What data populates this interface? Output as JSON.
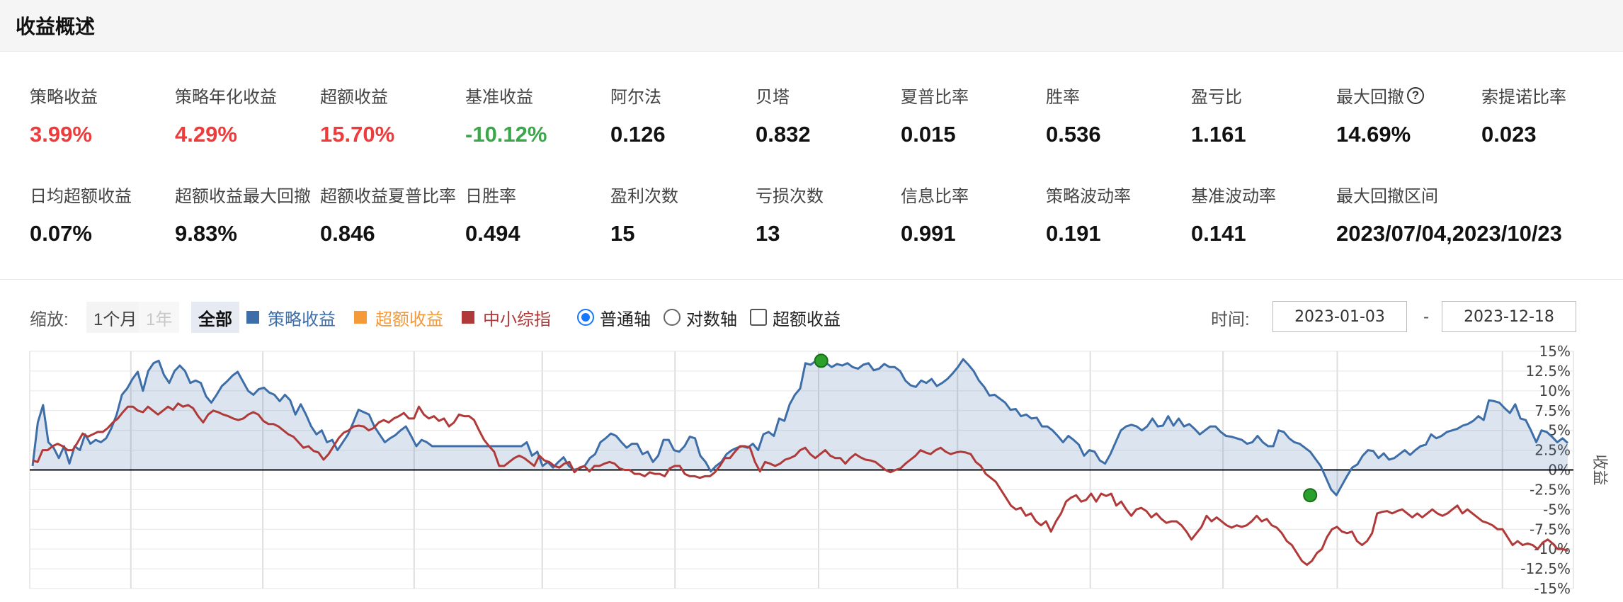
{
  "header": {
    "title": "收益概述"
  },
  "metrics_row1": [
    {
      "label": "策略收益",
      "value": "3.99%",
      "tone": "pos"
    },
    {
      "label": "策略年化收益",
      "value": "4.29%",
      "tone": "pos"
    },
    {
      "label": "超额收益",
      "value": "15.70%",
      "tone": "pos"
    },
    {
      "label": "基准收益",
      "value": "-10.12%",
      "tone": "neg"
    },
    {
      "label": "阿尔法",
      "value": "0.126",
      "tone": ""
    },
    {
      "label": "贝塔",
      "value": "0.832",
      "tone": ""
    },
    {
      "label": "夏普比率",
      "value": "0.015",
      "tone": ""
    },
    {
      "label": "胜率",
      "value": "0.536",
      "tone": ""
    },
    {
      "label": "盈亏比",
      "value": "1.161",
      "tone": ""
    },
    {
      "label": "最大回撤",
      "value": "14.69%",
      "tone": "",
      "help": "?"
    },
    {
      "label": "索提诺比率",
      "value": "0.023",
      "tone": ""
    }
  ],
  "metrics_row2": [
    {
      "label": "日均超额收益",
      "value": "0.07%"
    },
    {
      "label": "超额收益最大回撤",
      "value": "9.83%"
    },
    {
      "label": "超额收益夏普比率",
      "value": "0.846"
    },
    {
      "label": "日胜率",
      "value": "0.494"
    },
    {
      "label": "盈利次数",
      "value": "15"
    },
    {
      "label": "亏损次数",
      "value": "13"
    },
    {
      "label": "信息比率",
      "value": "0.991"
    },
    {
      "label": "策略波动率",
      "value": "0.191"
    },
    {
      "label": "基准波动率",
      "value": "0.141"
    },
    {
      "label": "最大回撤区间",
      "value": "2023/07/04,2023/10/23"
    }
  ],
  "toolbar": {
    "zoom_label": "缩放:",
    "zoom_options": [
      "1个月",
      "1年",
      "全部"
    ],
    "zoom_selected": "全部",
    "legend": [
      {
        "label": "策略收益",
        "color": "#3d6ea8"
      },
      {
        "label": "超额收益",
        "color": "#f59a38"
      },
      {
        "label": "中小综指",
        "color": "#b03a3a"
      }
    ],
    "axis_options": [
      "普通轴",
      "对数轴"
    ],
    "axis_selected": "普通轴",
    "excess_checkbox_label": "超额收益",
    "time_label": "时间:",
    "date_from": "2023-01-03",
    "date_sep": "-",
    "date_to": "2023-12-18"
  },
  "chart_data": {
    "type": "line",
    "ylabel": "收益",
    "yticks": [
      "15%",
      "12.5%",
      "10%",
      "7.5%",
      "5%",
      "2.5%",
      "0%",
      "-2.5%",
      "-5%",
      "-7.5%",
      "-10%",
      "-12.5%",
      "-15%"
    ],
    "ylim": [
      -15,
      15
    ],
    "grid": true,
    "series": [
      {
        "name": "策略收益",
        "color": "#3d6ea8",
        "fill": true,
        "values": [
          0.5,
          6.0,
          8.2,
          3.5,
          2.8,
          1.5,
          3.0,
          0.8,
          3.0,
          2.5,
          4.5,
          3.3,
          3.8,
          3.5,
          4.0,
          5.3,
          7.0,
          9.5,
          10.3,
          11.5,
          12.4,
          10.0,
          12.5,
          13.5,
          13.8,
          12.0,
          11.0,
          12.5,
          13.2,
          12.5,
          11.0,
          11.3,
          11.0,
          9.3,
          8.5,
          9.5,
          10.6,
          11.2,
          11.9,
          12.4,
          11.2,
          10.0,
          9.5,
          10.2,
          10.4,
          9.8,
          9.5,
          8.7,
          9.5,
          8.8,
          7.0,
          8.3,
          7.0,
          5.5,
          4.5,
          5.0,
          3.5,
          3.8,
          2.5,
          3.5,
          4.5,
          6.0,
          7.6,
          7.3,
          7.0,
          5.5,
          4.5,
          3.5,
          4.0,
          4.4,
          5.0,
          5.5,
          4.3,
          3.0,
          3.8,
          3.5,
          3.0,
          3.0,
          3.0,
          3.0,
          3.0,
          3.0,
          3.0,
          3.0,
          3.0,
          3.0,
          3.0,
          3.0,
          3.0,
          3.0,
          3.0,
          3.0,
          3.0,
          3.0,
          3.5,
          1.8,
          2.3,
          0.5,
          1.0,
          0.3,
          1.0,
          1.6,
          0.5,
          0.0,
          0.2,
          0.5,
          1.5,
          2.0,
          3.5,
          4.0,
          4.6,
          4.3,
          3.5,
          2.8,
          3.3,
          3.3,
          2.0,
          2.3,
          1.0,
          1.8,
          3.8,
          3.8,
          2.5,
          2.3,
          3.0,
          4.2,
          4.0,
          1.8,
          1.0,
          -0.2,
          0.5,
          1.0,
          2.0,
          2.5,
          2.8,
          3.0,
          2.8,
          3.3,
          2.5,
          4.5,
          4.8,
          4.3,
          6.5,
          6.2,
          8.3,
          9.5,
          10.3,
          13.5,
          13.3,
          13.8,
          13.4,
          13.5,
          13.0,
          13.4,
          13.2,
          13.5,
          13.0,
          12.8,
          13.3,
          13.5,
          12.6,
          12.8,
          13.4,
          13.0,
          13.0,
          12.5,
          11.3,
          10.7,
          10.5,
          11.3,
          11.0,
          11.5,
          10.6,
          11.0,
          11.5,
          12.2,
          13.0,
          14.0,
          13.3,
          12.5,
          11.3,
          10.5,
          9.4,
          9.5,
          9.0,
          8.5,
          7.6,
          7.7,
          6.8,
          7.0,
          6.5,
          6.6,
          5.5,
          5.5,
          5.0,
          4.3,
          3.5,
          4.3,
          3.8,
          3.2,
          1.8,
          2.5,
          2.3,
          1.2,
          0.8,
          2.0,
          3.5,
          5.0,
          5.5,
          5.7,
          5.5,
          5.0,
          5.5,
          6.5,
          5.5,
          5.6,
          6.8,
          5.6,
          6.5,
          5.5,
          5.8,
          5.2,
          4.5,
          5.0,
          5.5,
          5.5,
          4.8,
          4.3,
          4.2,
          4.0,
          3.8,
          3.3,
          3.5,
          4.3,
          3.5,
          3.0,
          3.0,
          5.0,
          4.8,
          4.0,
          3.5,
          3.3,
          2.8,
          2.3,
          1.4,
          0.5,
          -1.0,
          -2.5,
          -3.2,
          -2.0,
          -0.8,
          0.3,
          0.7,
          1.8,
          2.5,
          2.4,
          1.5,
          2.1,
          1.3,
          1.5,
          2.0,
          2.5,
          1.9,
          2.5,
          3.0,
          3.2,
          4.5,
          4.0,
          4.3,
          4.8,
          5.0,
          5.2,
          5.6,
          5.8,
          6.2,
          6.8,
          6.3,
          8.8,
          8.7,
          8.5,
          7.8,
          7.2,
          8.3,
          6.5,
          6.3,
          5.0,
          3.5,
          5.0,
          4.8,
          4.2,
          3.5,
          4.0,
          3.4
        ]
      },
      {
        "name": "中小综指",
        "color": "#b03a3a",
        "fill": false,
        "values": [
          1.2,
          1.0,
          2.5,
          2.5,
          3.0,
          3.3,
          3.0,
          2.5,
          2.5,
          3.5,
          4.6,
          4.2,
          4.5,
          4.8,
          4.8,
          5.3,
          6.0,
          6.5,
          7.3,
          8.0,
          8.0,
          7.5,
          7.3,
          8.0,
          7.5,
          7.0,
          7.5,
          8.0,
          7.6,
          8.4,
          8.0,
          8.2,
          7.8,
          6.8,
          6.0,
          7.0,
          7.5,
          7.3,
          7.0,
          6.8,
          6.5,
          6.3,
          6.5,
          7.0,
          7.3,
          7.0,
          6.2,
          5.8,
          5.8,
          5.5,
          5.0,
          4.5,
          4.2,
          3.5,
          2.8,
          3.0,
          2.4,
          2.2,
          1.3,
          2.0,
          3.0,
          4.0,
          4.7,
          5.0,
          5.5,
          5.6,
          5.5,
          5.0,
          5.3,
          6.0,
          6.3,
          6.0,
          6.5,
          6.8,
          7.2,
          6.5,
          6.5,
          8.0,
          7.0,
          6.5,
          6.8,
          6.2,
          6.5,
          5.5,
          6.0,
          7.0,
          6.8,
          6.8,
          6.3,
          5.0,
          3.8,
          3.0,
          2.3,
          0.5,
          0.5,
          1.0,
          1.5,
          1.8,
          1.5,
          1.0,
          0.5,
          1.8,
          1.2,
          1.0,
          0.5,
          0.3,
          0.8,
          1.0,
          -0.3,
          0.3,
          0.5,
          -0.2,
          0.5,
          0.5,
          0.8,
          1.0,
          0.8,
          0.2,
          0.0,
          0.0,
          -0.5,
          -0.5,
          -0.8,
          -0.3,
          -0.5,
          -0.5,
          -0.8,
          0.2,
          0.5,
          0.5,
          -0.5,
          -0.8,
          -0.8,
          -1.0,
          -0.8,
          -0.8,
          -0.3,
          0.5,
          1.5,
          1.5,
          2.3,
          3.0,
          3.0,
          2.8,
          1.0,
          -0.2,
          1.0,
          0.8,
          0.5,
          0.8,
          1.3,
          1.5,
          1.8,
          2.5,
          2.8,
          2.0,
          1.5,
          2.0,
          2.5,
          1.8,
          1.5,
          1.5,
          0.8,
          1.5,
          2.0,
          1.6,
          1.3,
          1.2,
          1.0,
          0.5,
          0.0,
          -0.3,
          0.0,
          0.2,
          0.8,
          1.3,
          1.8,
          2.5,
          2.2,
          2.0,
          2.5,
          2.8,
          2.3,
          2.0,
          2.2,
          2.3,
          2.2,
          2.0,
          1.0,
          0.5,
          -0.5,
          -1.0,
          -1.5,
          -2.5,
          -3.5,
          -4.5,
          -5.0,
          -4.8,
          -5.8,
          -5.5,
          -6.5,
          -7.0,
          -6.5,
          -7.8,
          -6.5,
          -5.5,
          -4.0,
          -3.5,
          -3.2,
          -4.0,
          -3.8,
          -3.0,
          -4.0,
          -3.0,
          -3.3,
          -3.0,
          -4.5,
          -4.0,
          -5.0,
          -5.8,
          -5.0,
          -4.8,
          -5.2,
          -6.0,
          -5.5,
          -6.2,
          -6.7,
          -6.5,
          -6.5,
          -7.0,
          -7.8,
          -8.8,
          -8.0,
          -7.2,
          -5.8,
          -6.5,
          -6.0,
          -6.5,
          -7.0,
          -7.3,
          -7.0,
          -7.2,
          -7.0,
          -6.5,
          -5.8,
          -6.5,
          -6.2,
          -7.0,
          -7.3,
          -8.0,
          -9.0,
          -9.5,
          -10.5,
          -11.5,
          -12.0,
          -11.5,
          -10.5,
          -10.0,
          -8.5,
          -7.5,
          -7.2,
          -7.8,
          -8.0,
          -7.8,
          -9.0,
          -9.5,
          -9.0,
          -8.0,
          -5.5,
          -5.3,
          -5.2,
          -5.5,
          -5.2,
          -5.0,
          -5.5,
          -6.0,
          -5.5,
          -6.0,
          -5.5,
          -5.0,
          -5.5,
          -5.8,
          -5.5,
          -5.0,
          -4.5,
          -5.5,
          -5.0,
          -5.5,
          -6.0,
          -6.5,
          -6.7,
          -7.0,
          -7.5,
          -7.5,
          -8.5,
          -9.5,
          -9.0,
          -9.5,
          -9.3,
          -9.5,
          -10.0,
          -9.2,
          -8.8,
          -9.3,
          -10.0,
          -10.0,
          -10.2
        ]
      }
    ],
    "markers": [
      {
        "series": "策略收益",
        "date": "2023-07-04",
        "value": 13.8
      },
      {
        "series": "策略收益",
        "date": "2023-10-23",
        "value": -3.2
      }
    ]
  }
}
